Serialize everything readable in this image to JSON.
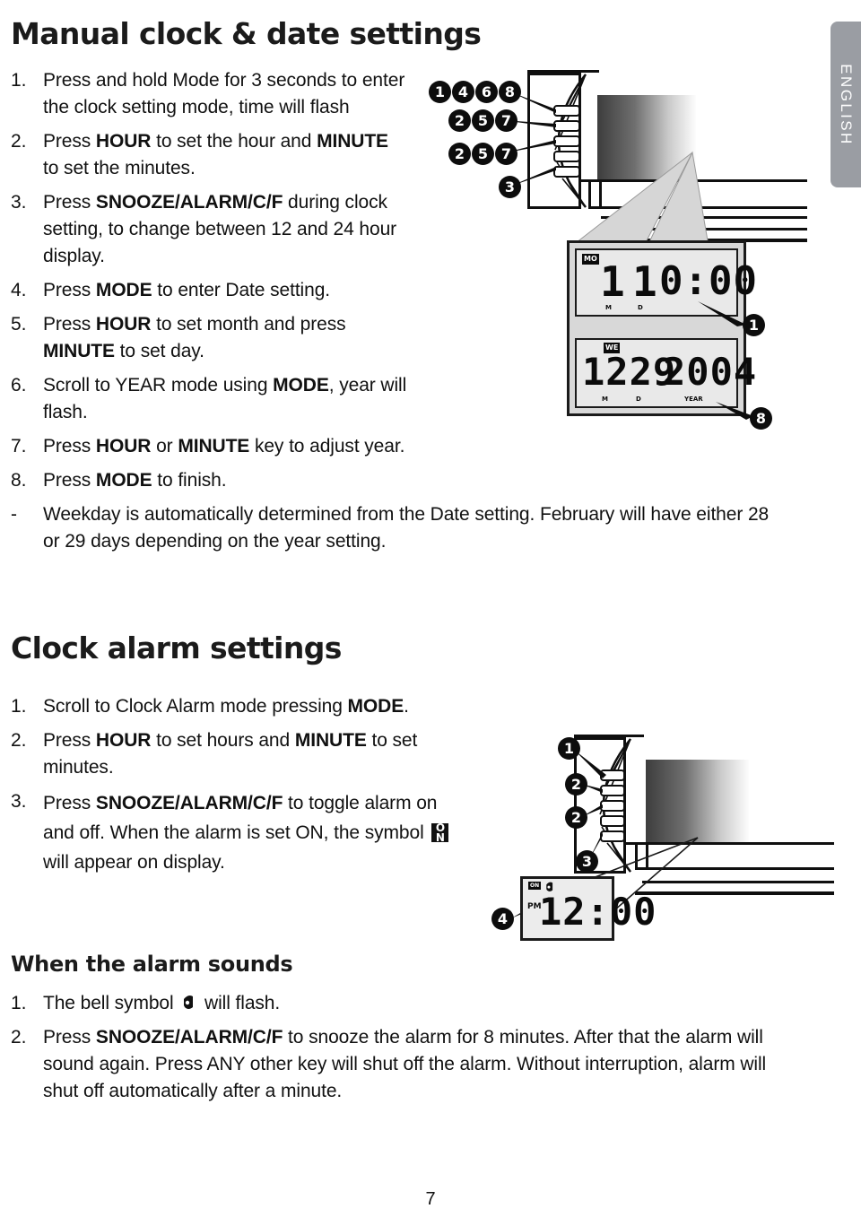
{
  "language_tab": {
    "label": "ENGLISH"
  },
  "page": {
    "number": "7"
  },
  "section1": {
    "heading": "Manual clock & date settings",
    "items": [
      {
        "num": "1.",
        "html": "Press and hold Mode for 3 seconds to enter the clock setting mode, time will flash"
      },
      {
        "num": "2.",
        "html": "Press <b>HOUR</b> to set the hour and <b>MINUTE</b> to set the minutes."
      },
      {
        "num": "3.",
        "html": "Press <b>SNOOZE/ALARM/C/F</b> during clock setting, to change between 12 and 24 hour display."
      },
      {
        "num": "4.",
        "html": "Press <b>MODE</b> to enter Date setting."
      },
      {
        "num": "5.",
        "html": "Press <b>HOUR</b> to set month and press <b>MINUTE</b> to set day."
      },
      {
        "num": "6.",
        "html": "Scroll to YEAR mode using <b>MODE</b>, year will flash."
      },
      {
        "num": "7.",
        "html": "Press <b>HOUR</b> or <b>MINUTE</b> key to adjust year."
      },
      {
        "num": "8.",
        "html": "Press <b>MODE</b> to finish."
      }
    ],
    "note": {
      "num": "-",
      "html": "Weekday is automatically determined from the Date setting. February will have either 28 or 29 days depending on the year setting."
    }
  },
  "section2": {
    "heading": "Clock alarm settings",
    "items": [
      {
        "num": "1.",
        "html": "Scroll to Clock Alarm mode pressing <b>MODE</b>."
      },
      {
        "num": "2.",
        "html": "Press  <b>HOUR</b> to set hours and <b>MINUTE</b> to set minutes."
      },
      {
        "num": "3.",
        "html": "Press <b>SNOOZE/ALARM/C/F</b> to toggle alarm on and off. When the alarm is set ON, the symbol <span class=\"on-sym\" data-name=\"alarm-on-icon\" data-interactable=\"false\"><i class=\"o\">O</i><i class=\"n\">N</i></span> will appear on display."
      }
    ]
  },
  "section3": {
    "heading": "When the alarm sounds",
    "items": [
      {
        "num": "1.",
        "html": "The bell symbol <svg class=\"bell-sym\" data-name=\"bell-icon\" viewBox=\"0 0 17 19\"><path d=\"M3 12 L3 5 Q8 -1 13 2 L13 14 Q8 18 4 14 Z\" fill=\"#111\"/><circle cx=\"7\" cy=\"9\" r=\"2.2\" fill=\"#fff\"/></svg> will flash."
      },
      {
        "num": "2.",
        "html": "Press <b>SNOOZE/ALARM/C/F</b> to snooze the alarm for 8 minutes. After that the alarm will sound again. Press ANY other key will shut off the alarm. Without interruption, alarm will shut off automatically after a minute."
      }
    ]
  },
  "diagram_top": {
    "callouts": [
      {
        "label": "1"
      },
      {
        "label": "4"
      },
      {
        "label": "6"
      },
      {
        "label": "8"
      },
      {
        "label": "2"
      },
      {
        "label": "5"
      },
      {
        "label": "7"
      },
      {
        "label": "2"
      },
      {
        "label": "5"
      },
      {
        "label": "7"
      },
      {
        "label": "3"
      }
    ],
    "lcd_top": {
      "day_badge": "MO",
      "month": "1",
      "month_label": "M",
      "day": "1",
      "day_label": "D",
      "time": "0:00",
      "callout": "1"
    },
    "lcd_bottom": {
      "day_badge": "WE",
      "date": "1229",
      "month_label": "M",
      "day_label": "D",
      "year": "2004",
      "year_label": "YEAR",
      "callout": "8"
    }
  },
  "diagram_bottom": {
    "callouts": [
      {
        "label": "1"
      },
      {
        "label": "2"
      },
      {
        "label": "2"
      },
      {
        "label": "3"
      },
      {
        "label": "4"
      }
    ],
    "lcd": {
      "alarm_badge": "ON",
      "ampm": "PM",
      "time": "12:00"
    }
  }
}
